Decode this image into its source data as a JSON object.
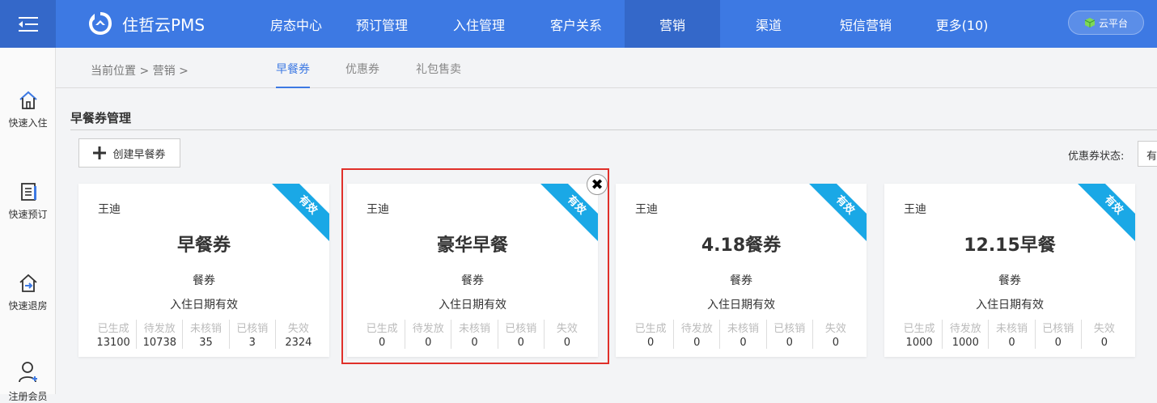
{
  "header": {
    "brand": "住哲云PMS",
    "nav": [
      "房态中心",
      "预订管理",
      "入住管理",
      "客户关系",
      "营销",
      "渠道",
      "短信营销",
      "更多(10)"
    ],
    "active_nav_index": 4,
    "cloud_button": "云平台",
    "colors": {
      "primary": "#3d79e3",
      "active": "#3468c9",
      "ribbon": "#1aa8e6",
      "selection": "#e0302a"
    }
  },
  "sidebar": {
    "items": [
      {
        "label": "快速入住",
        "icon": "home-icon"
      },
      {
        "label": "快速预订",
        "icon": "document-icon"
      },
      {
        "label": "快速退房",
        "icon": "checkout-icon"
      },
      {
        "label": "注册会员",
        "icon": "add-user-icon"
      }
    ]
  },
  "subbar": {
    "breadcrumb": "当前位置 > 营销 >",
    "tabs": [
      "早餐券",
      "优惠券",
      "礼包售卖"
    ],
    "active_tab_index": 0
  },
  "section": {
    "title": "早餐券管理",
    "create_button": "创建早餐券",
    "status_label": "优惠券状态:",
    "status_value": "有"
  },
  "cards": [
    {
      "owner": "王迪",
      "name": "早餐券",
      "type": "餐券",
      "validity": "入住日期有效",
      "badge": "有效",
      "stats": [
        {
          "label": "已生成",
          "value": "13100"
        },
        {
          "label": "待发放",
          "value": "10738"
        },
        {
          "label": "未核销",
          "value": "35"
        },
        {
          "label": "已核销",
          "value": "3"
        },
        {
          "label": "失效",
          "value": "2324"
        }
      ]
    },
    {
      "owner": "王迪",
      "name": "豪华早餐",
      "type": "餐券",
      "validity": "入住日期有效",
      "badge": "有效",
      "stats": [
        {
          "label": "已生成",
          "value": "0"
        },
        {
          "label": "待发放",
          "value": "0"
        },
        {
          "label": "未核销",
          "value": "0"
        },
        {
          "label": "已核销",
          "value": "0"
        },
        {
          "label": "失效",
          "value": "0"
        }
      ]
    },
    {
      "owner": "王迪",
      "name": "4.18餐券",
      "type": "餐券",
      "validity": "入住日期有效",
      "badge": "有效",
      "stats": [
        {
          "label": "已生成",
          "value": "0"
        },
        {
          "label": "待发放",
          "value": "0"
        },
        {
          "label": "未核销",
          "value": "0"
        },
        {
          "label": "已核销",
          "value": "0"
        },
        {
          "label": "失效",
          "value": "0"
        }
      ]
    },
    {
      "owner": "王迪",
      "name": "12.15早餐",
      "type": "餐券",
      "validity": "入住日期有效",
      "badge": "有效",
      "stats": [
        {
          "label": "已生成",
          "value": "1000"
        },
        {
          "label": "待发放",
          "value": "1000"
        },
        {
          "label": "未核销",
          "value": "0"
        },
        {
          "label": "已核销",
          "value": "0"
        },
        {
          "label": "失效",
          "value": "0"
        }
      ]
    }
  ],
  "selected_card_index": 1
}
